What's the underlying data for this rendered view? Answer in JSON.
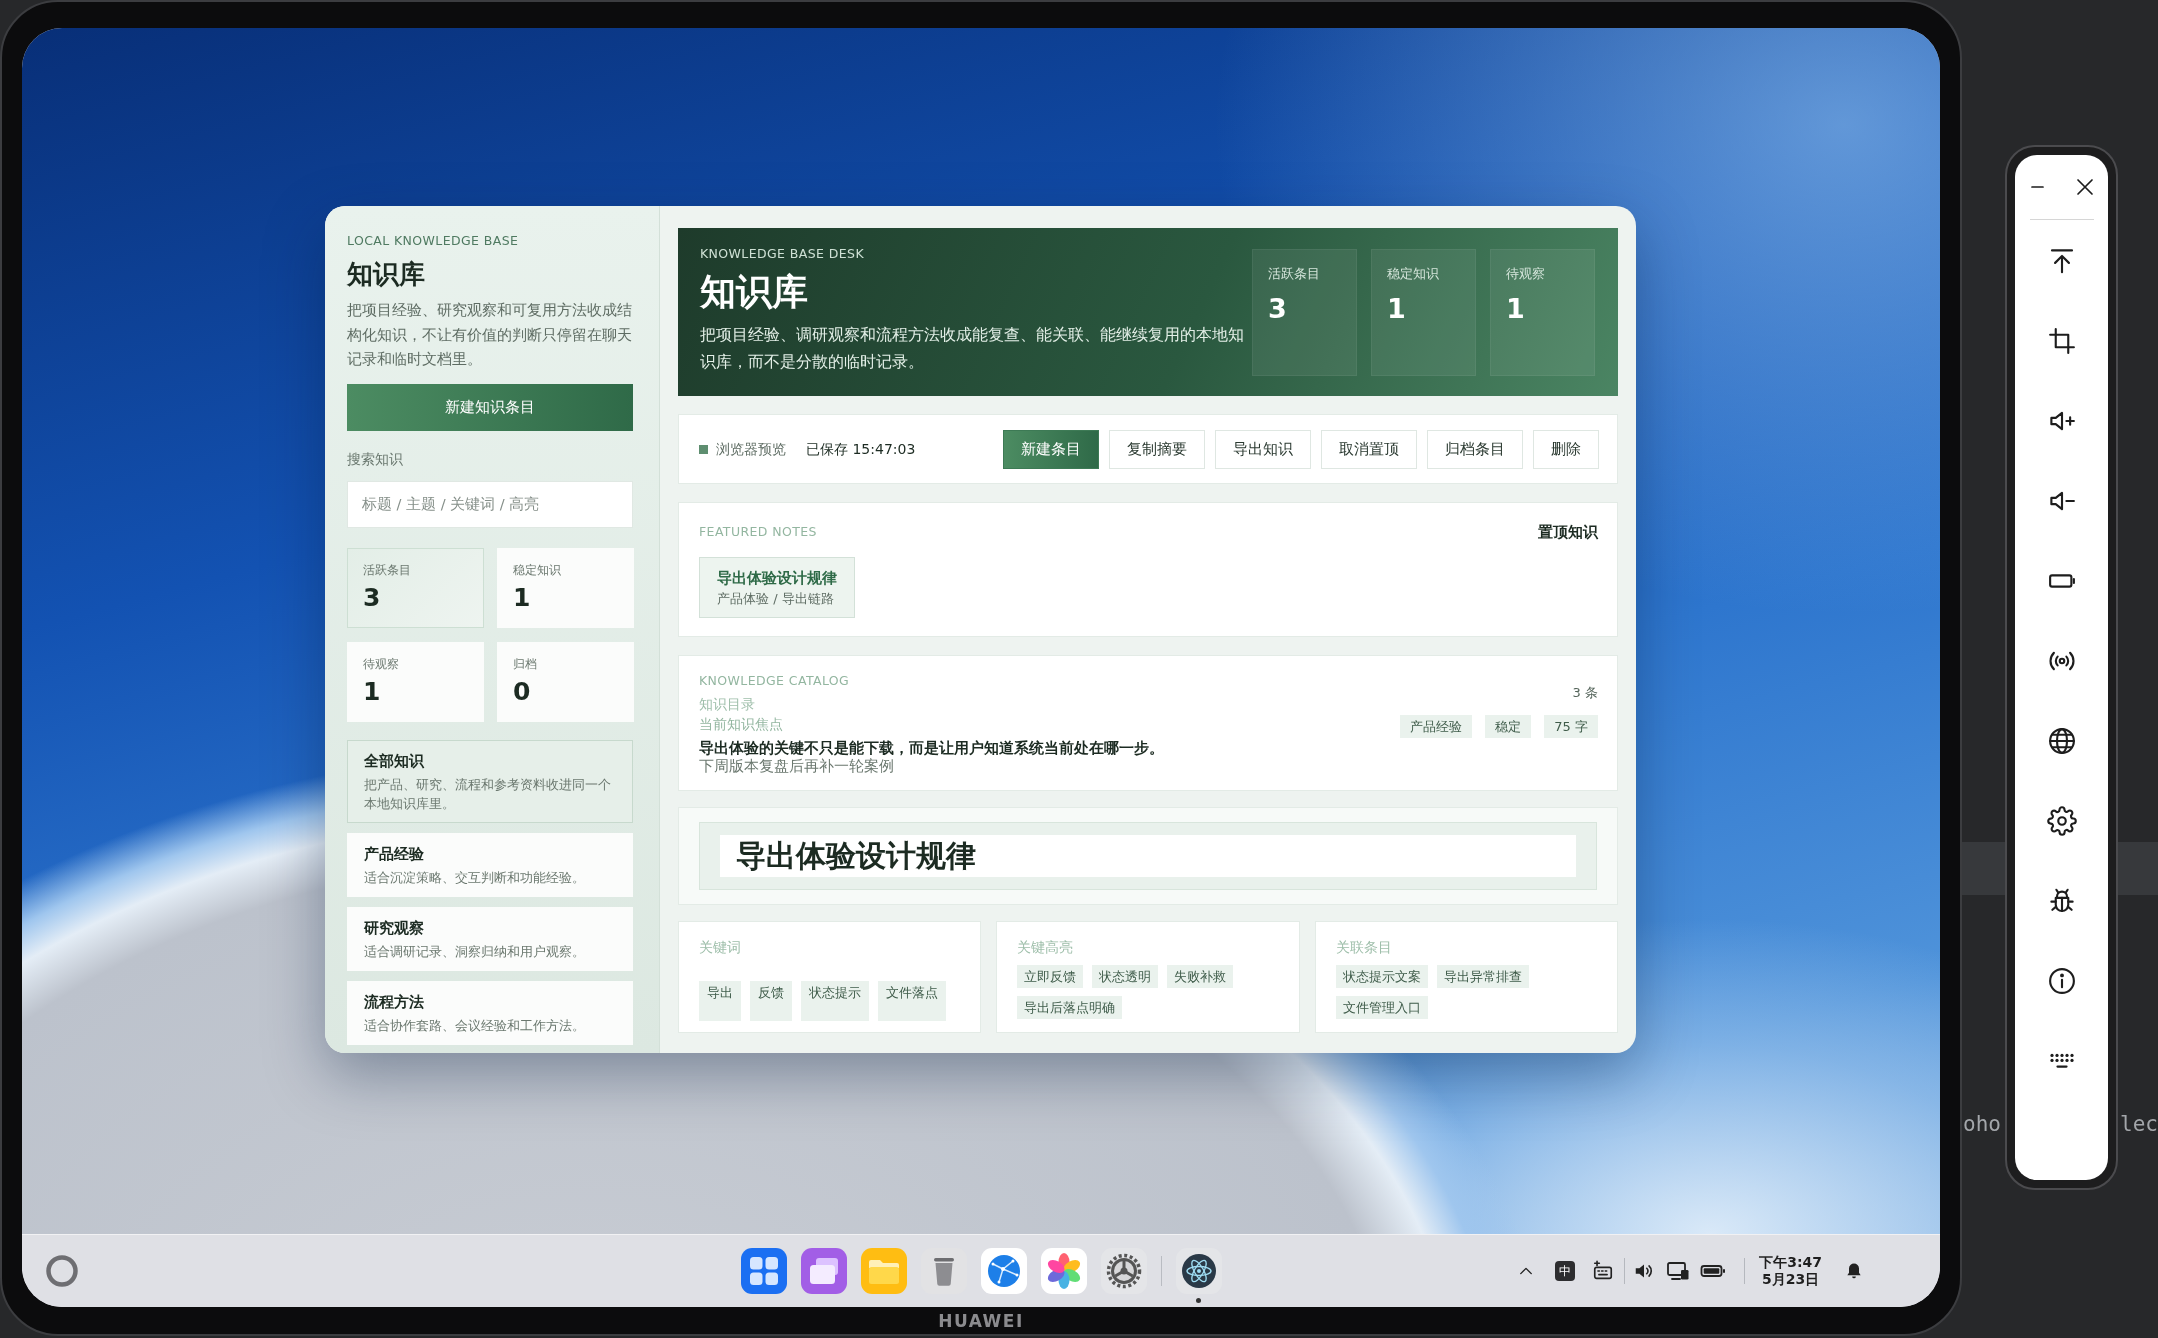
{
  "device": {
    "brand_label": "HUAWEI"
  },
  "app": {
    "sidebar": {
      "eyebrow": "LOCAL KNOWLEDGE BASE",
      "title": "知识库",
      "description": "把项目经验、研究观察和可复用方法收成结构化知识，不让有价值的判断只停留在聊天记录和临时文档里。",
      "new_button": "新建知识条目",
      "search": {
        "label": "搜索知识",
        "placeholder": "标题 / 主题 / 关键词 / 高亮"
      },
      "stats": [
        {
          "label": "活跃条目",
          "value": "3",
          "selected": true
        },
        {
          "label": "稳定知识",
          "value": "1",
          "selected": false
        },
        {
          "label": "待观察",
          "value": "1",
          "selected": false
        },
        {
          "label": "归档",
          "value": "0",
          "selected": false
        }
      ],
      "categories": [
        {
          "title": "全部知识",
          "description": "把产品、研究、流程和参考资料收进同一个本地知识库里。",
          "selected": true
        },
        {
          "title": "产品经验",
          "description": "适合沉淀策略、交互判断和功能经验。",
          "selected": false
        },
        {
          "title": "研究观察",
          "description": "适合调研记录、洞察归纳和用户观察。",
          "selected": false
        },
        {
          "title": "流程方法",
          "description": "适合协作套路、会议经验和工作方法。",
          "selected": false
        }
      ]
    },
    "header": {
      "eyebrow": "KNOWLEDGE BASE DESK",
      "title": "知识库",
      "description": "把项目经验、调研观察和流程方法收成能复查、能关联、能继续复用的本地知识库，而不是分散的临时记录。",
      "stats": [
        {
          "label": "活跃条目",
          "value": "3"
        },
        {
          "label": "稳定知识",
          "value": "1"
        },
        {
          "label": "待观察",
          "value": "1"
        }
      ]
    },
    "toolbar": {
      "status": "浏览器预览",
      "saved": "已保存 15:47:03",
      "buttons": [
        {
          "label": "新建条目",
          "primary": true
        },
        {
          "label": "复制摘要",
          "primary": false
        },
        {
          "label": "导出知识",
          "primary": false
        },
        {
          "label": "取消置顶",
          "primary": false
        },
        {
          "label": "归档条目",
          "primary": false
        },
        {
          "label": "删除",
          "primary": false
        }
      ]
    },
    "featured": {
      "eyebrow": "FEATURED NOTES",
      "heading": "置顶知识",
      "notes": [
        {
          "title": "导出体验设计规律",
          "meta": "产品体验 / 导出链路"
        }
      ]
    },
    "catalog": {
      "eyebrow": "KNOWLEDGE CATALOG",
      "title": "知识目录",
      "count": "3 条",
      "focus": {
        "label": "当前知识焦点",
        "summary": "导出体验的关键不只是能下载，而是让用户知道系统当前处在哪一步。",
        "note": "下周版本复盘后再补一轮案例",
        "tags": [
          "产品经验",
          "稳定",
          "75 字"
        ]
      }
    },
    "preview": {
      "title": "导出体验设计规律"
    },
    "panels": [
      {
        "kind": "keywords",
        "title": "关键词",
        "chips": [
          "导出",
          "反馈",
          "状态提示",
          "文件落点"
        ]
      },
      {
        "kind": "highlights",
        "title": "关键高亮",
        "chips": [
          "立即反馈",
          "状态透明",
          "失败补救",
          "导出后落点明确"
        ]
      },
      {
        "kind": "links",
        "title": "关联条目",
        "chips": [
          "状态提示文案",
          "导出异常排查",
          "文件管理入口"
        ]
      }
    ]
  },
  "taskbar": {
    "dock": [
      {
        "kind": "grid",
        "running": false
      },
      {
        "kind": "windows",
        "running": false
      },
      {
        "kind": "folder",
        "running": false
      },
      {
        "kind": "trash",
        "running": false
      },
      {
        "kind": "browser",
        "running": false
      },
      {
        "kind": "gallery",
        "running": false
      },
      {
        "kind": "settings",
        "running": false
      },
      {
        "kind": "atom",
        "running": true
      }
    ],
    "input_method": "中",
    "time": "下午3:47",
    "date": "5月23日"
  },
  "background_editor": {
    "fragments": [
      "oho",
      "lec"
    ]
  }
}
